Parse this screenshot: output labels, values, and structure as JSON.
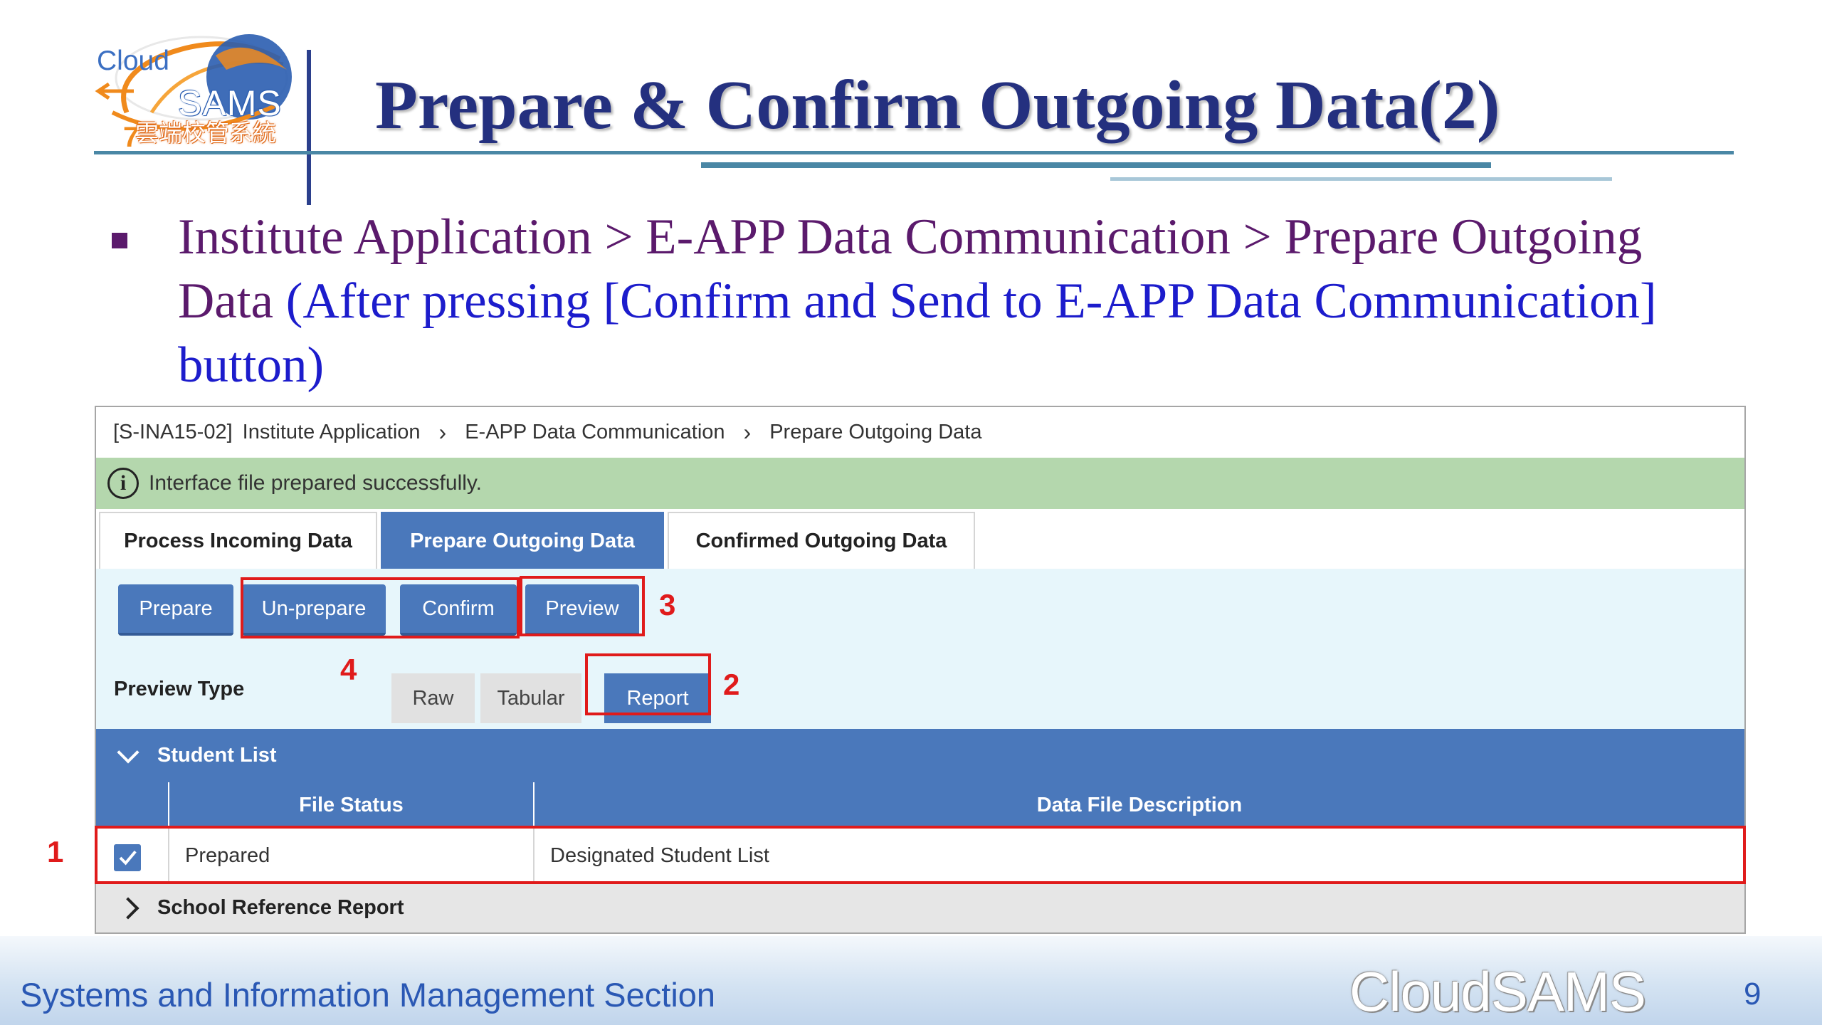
{
  "slide": {
    "title": "Prepare & Confirm Outgoing Data(2)",
    "bullet_path": "Institute Application > E-APP Data Communication > Prepare Outgoing Data",
    "bullet_note": " (After pressing [Confirm and Send to E-APP Data Communication] button)",
    "footer_left": "Systems and Information Management Section",
    "footer_brand": "CloudSAMS",
    "page_number": "9"
  },
  "logo": {
    "cloud": "Cloud",
    "sams": "SAMS",
    "chinese": "雲端校管系統"
  },
  "breadcrumb": {
    "code": "[S-INA15-02]",
    "items": [
      "Institute Application",
      "E-APP Data Communication",
      "Prepare Outgoing Data"
    ]
  },
  "message": {
    "text": "Interface file prepared successfully."
  },
  "tabs": [
    {
      "label": "Process Incoming Data",
      "active": false
    },
    {
      "label": "Prepare Outgoing Data",
      "active": true
    },
    {
      "label": "Confirmed Outgoing Data",
      "active": false
    }
  ],
  "actions": {
    "prepare": "Prepare",
    "unprepare": "Un-prepare",
    "confirm": "Confirm",
    "preview": "Preview"
  },
  "preview_type": {
    "label": "Preview Type",
    "options": [
      "Raw",
      "Tabular",
      "Report"
    ],
    "selected": "Report"
  },
  "student_list": {
    "title": "Student List",
    "columns": [
      "",
      "File Status",
      "Data File Description"
    ],
    "rows": [
      {
        "checked": true,
        "file_status": "Prepared",
        "description": "Designated Student List"
      }
    ]
  },
  "school_reference": {
    "title": "School Reference Report"
  },
  "annotations": [
    "1",
    "2",
    "3",
    "4"
  ],
  "colors": {
    "primary_blue": "#4a78bb",
    "success_green": "#b4d7ad",
    "panel_bg": "#e7f6fb",
    "annotation_red": "#e01b1b",
    "title_navy": "#24307f",
    "bullet_purple": "#5b1a6c",
    "note_blue": "#1c1ccc"
  }
}
